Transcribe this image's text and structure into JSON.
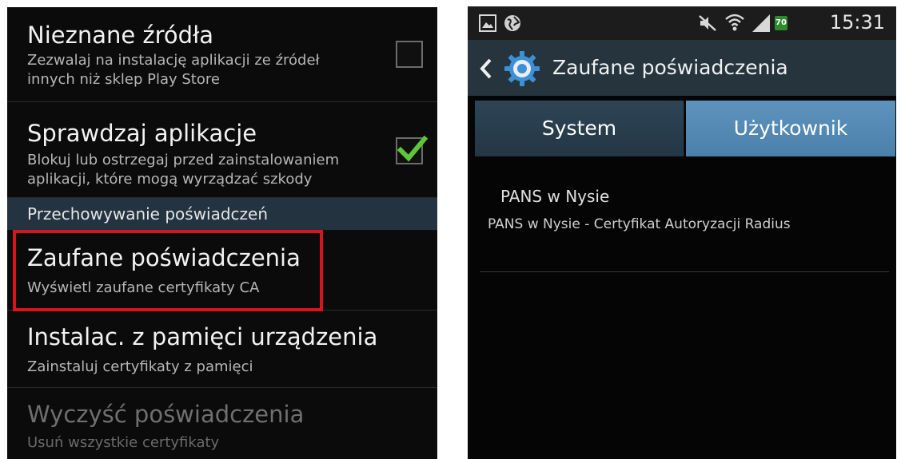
{
  "left_screen": {
    "rows": [
      {
        "title": "Nieznane źródła",
        "sub1": "Zezwalaj na instalację aplikacji ze źródeł",
        "sub2": "innych niż sklep Play Store",
        "checked": false
      },
      {
        "title": "Sprawdzaj aplikacje",
        "sub1": "Blokuj lub ostrzegaj przed zainstalowaniem",
        "sub2": "aplikacji, które mogą wyrządzać szkody",
        "checked": true
      }
    ],
    "section_header": "Przechowywanie poświadczeń",
    "items": [
      {
        "title": "Zaufane poświadczenia",
        "sub": "Wyświetl zaufane certyfikaty CA"
      },
      {
        "title": "Instalac. z pamięci urządzenia",
        "sub": "Zainstaluj certyfikaty z pamięci"
      },
      {
        "title": "Wyczyść poświadczenia",
        "sub": "Usuń wszystkie certyfikaty",
        "disabled": true
      }
    ],
    "highlight_color": "#d8141d",
    "check_color": "#5fc63a"
  },
  "right_screen": {
    "status_bar": {
      "time": "15:31",
      "battery": "70"
    },
    "action_bar": {
      "title": "Zaufane poświadczenia"
    },
    "tabs": [
      {
        "label": "System",
        "selected": false
      },
      {
        "label": "Użytkownik",
        "selected": true
      }
    ],
    "certificate": {
      "name": "PANS w Nysie",
      "description": "PANS w Nysie  - Certyfikat Autoryzacji Radius"
    },
    "accent_color": "#4a80aa"
  }
}
